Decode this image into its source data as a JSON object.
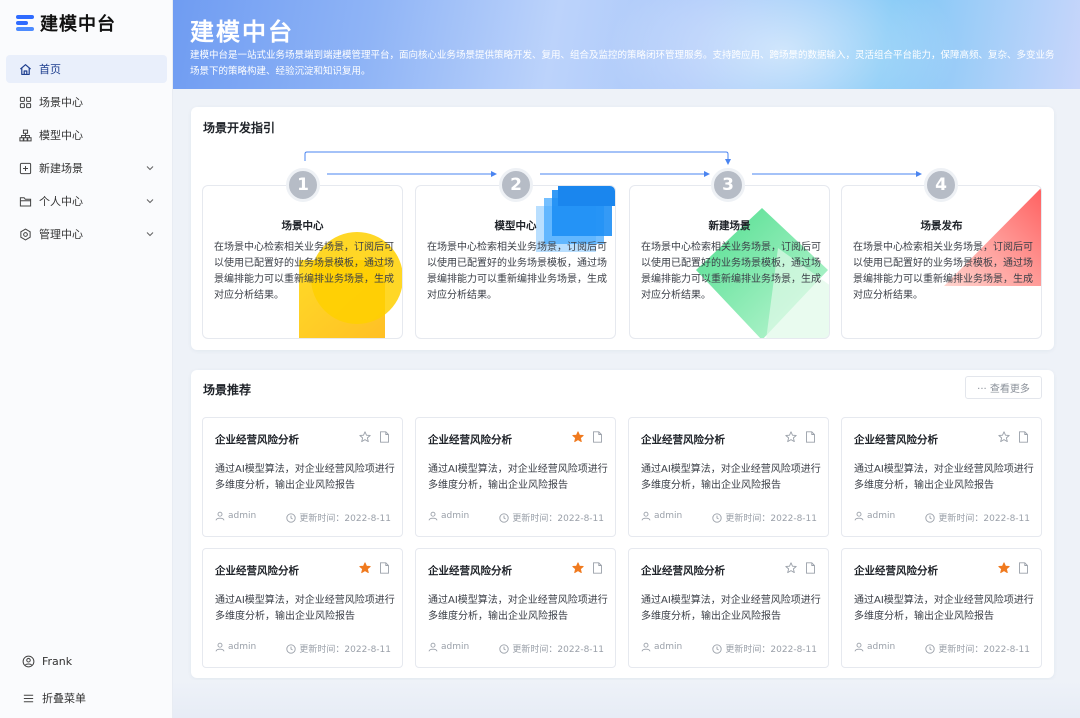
{
  "app": {
    "logo_text": "建模中台"
  },
  "sidebar": {
    "items": [
      {
        "label": "首页",
        "icon": "home-icon",
        "active": true
      },
      {
        "label": "场景中心",
        "icon": "grid-icon"
      },
      {
        "label": "模型中心",
        "icon": "hierarchy-icon"
      },
      {
        "label": "新建场景",
        "icon": "plus-square-icon",
        "expandable": true
      },
      {
        "label": "个人中心",
        "icon": "folder-icon",
        "expandable": true
      },
      {
        "label": "管理中心",
        "icon": "gear-icon",
        "expandable": true
      }
    ],
    "user_name": "Frank",
    "collapse_label": "折叠菜单"
  },
  "banner": {
    "title": "建模中台",
    "description": "建模中台是一站式业务场景端到端建模管理平台，面向核心业务场景提供策略开发、复用、组合及监控的策略闭环管理服务。支持跨应用、跨场景的数据输入，灵活组合平台能力，保障高频、复杂、多变业务场景下的策略构建、经验沉淀和知识复用。"
  },
  "guide": {
    "title": "场景开发指引",
    "steps": [
      {
        "num": "1",
        "title": "场景中心",
        "desc": "在场景中心检索相关业务场景，订阅后可以使用已配置好的业务场景模板，通过场景编排能力可以重新编排业务场景，生成对应分析结果。"
      },
      {
        "num": "2",
        "title": "模型中心",
        "desc": "在场景中心检索相关业务场景，订阅后可以使用已配置好的业务场景模板，通过场景编排能力可以重新编排业务场景，生成对应分析结果。"
      },
      {
        "num": "3",
        "title": "新建场景",
        "desc": "在场景中心检索相关业务场景，订阅后可以使用已配置好的业务场景模板，通过场景编排能力可以重新编排业务场景，生成对应分析结果。"
      },
      {
        "num": "4",
        "title": "场景发布",
        "desc": "在场景中心检索相关业务场景，订阅后可以使用已配置好的业务场景模板，通过场景编排能力可以重新编排业务场景，生成对应分析结果。"
      }
    ]
  },
  "recommend": {
    "title": "场景推荐",
    "more_label": "··· 查看更多",
    "cards": [
      {
        "title": "企业经营风险分析",
        "starred": false,
        "desc": "通过AI模型算法，对企业经营风险项进行多维度分析，输出企业风险报告",
        "author": "admin",
        "time": "更新时间：2022-8-11"
      },
      {
        "title": "企业经营风险分析",
        "starred": true,
        "desc": "通过AI模型算法，对企业经营风险项进行多维度分析，输出企业风险报告",
        "author": "admin",
        "time": "更新时间：2022-8-11"
      },
      {
        "title": "企业经营风险分析",
        "starred": false,
        "desc": "通过AI模型算法，对企业经营风险项进行多维度分析，输出企业风险报告",
        "author": "admin",
        "time": "更新时间：2022-8-11"
      },
      {
        "title": "企业经营风险分析",
        "starred": false,
        "desc": "通过AI模型算法，对企业经营风险项进行多维度分析，输出企业风险报告",
        "author": "admin",
        "time": "更新时间：2022-8-11"
      },
      {
        "title": "企业经营风险分析",
        "starred": true,
        "desc": "通过AI模型算法，对企业经营风险项进行多维度分析，输出企业风险报告",
        "author": "admin",
        "time": "更新时间：2022-8-11"
      },
      {
        "title": "企业经营风险分析",
        "starred": true,
        "desc": "通过AI模型算法，对企业经营风险项进行多维度分析，输出企业风险报告",
        "author": "admin",
        "time": "更新时间：2022-8-11"
      },
      {
        "title": "企业经营风险分析",
        "starred": false,
        "desc": "通过AI模型算法，对企业经营风险项进行多维度分析，输出企业风险报告",
        "author": "admin",
        "time": "更新时间：2022-8-11"
      },
      {
        "title": "企业经营风险分析",
        "starred": true,
        "desc": "通过AI模型算法，对企业经营风险项进行多维度分析，输出企业风险报告",
        "author": "admin",
        "time": "更新时间：2022-8-11"
      }
    ]
  },
  "colors": {
    "accent": "#2f6bff",
    "star_active": "#f07a1f",
    "step_circle": "#b6bcc6",
    "flow_line": "#4a84f0"
  }
}
